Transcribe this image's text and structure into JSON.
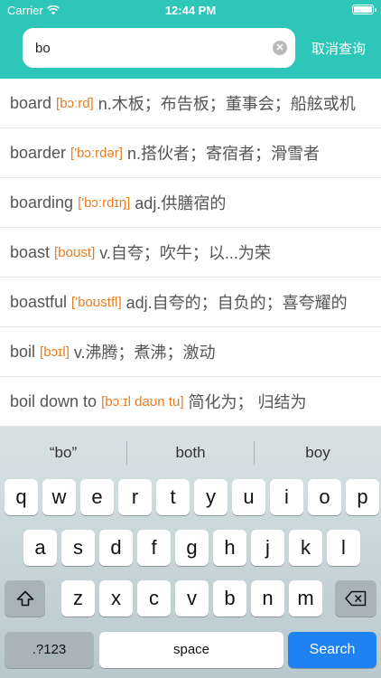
{
  "status_bar": {
    "carrier": "Carrier",
    "time": "12:44 PM",
    "battery_level": 1.0
  },
  "search": {
    "value": "bo",
    "placeholder": "",
    "cancel_label": "取消查询"
  },
  "results": [
    {
      "word": "board",
      "phonetic": "[bɔːrd]",
      "meaning": "n.木板；布告板；董事会；船舷或机"
    },
    {
      "word": "boarder",
      "phonetic": "['bɔːrdər]",
      "meaning": "n.搭伙者；寄宿者；滑雪者"
    },
    {
      "word": "boarding",
      "phonetic": "['bɔːrdɪŋ]",
      "meaning": "adj.供膳宿的"
    },
    {
      "word": "boast",
      "phonetic": "[boʊst]",
      "meaning": "v.自夸；吹牛；以...为荣"
    },
    {
      "word": "boastful",
      "phonetic": "['boʊstfl]",
      "meaning": "adj.自夸的；自负的；喜夸耀的"
    },
    {
      "word": "boil",
      "phonetic": "[bɔɪl]",
      "meaning": "v.沸腾；煮沸；激动"
    },
    {
      "word": "boil down to",
      "phonetic": "[bɔːɪl daʊn tu]",
      "meaning": "简化为； 归结为"
    }
  ],
  "keyboard": {
    "suggestions": [
      "“bo”",
      "both",
      "boy"
    ],
    "row1": [
      "q",
      "w",
      "e",
      "r",
      "t",
      "y",
      "u",
      "i",
      "o",
      "p"
    ],
    "row2": [
      "a",
      "s",
      "d",
      "f",
      "g",
      "h",
      "j",
      "k",
      "l"
    ],
    "row3": [
      "z",
      "x",
      "c",
      "v",
      "b",
      "n",
      "m"
    ],
    "numbers_label": ".?123",
    "space_label": "space",
    "search_label": "Search",
    "search_key_color": "#1f82f3"
  },
  "colors": {
    "header": "#2dc6b8",
    "phonetic": "#e97c1d"
  }
}
